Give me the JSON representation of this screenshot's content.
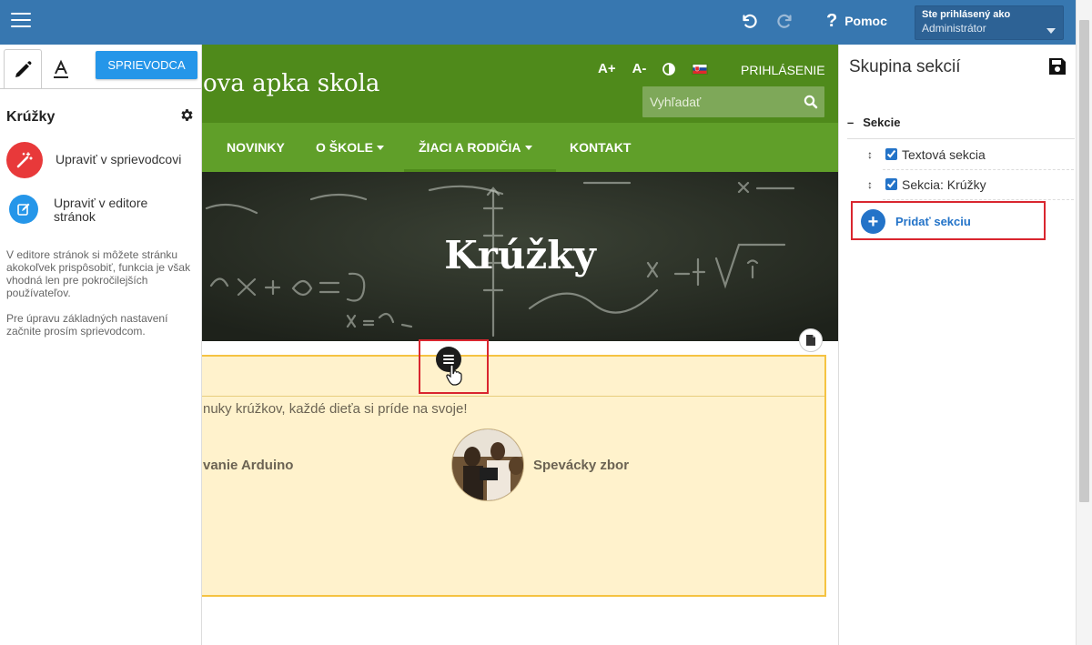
{
  "topbar": {
    "help_label": "Pomoc",
    "help_icon": "question-icon",
    "user_line1": "Ste prihlásený ako",
    "user_line2": "Administrátor"
  },
  "left_panel": {
    "guide_button": "SPRIEVODCA",
    "title": "Krúžky",
    "action_wizard": "Upraviť v sprievodcovi",
    "action_editor": "Upraviť v editore stránok",
    "desc1": "V editore stránok si môžete stránku akokoľvek prispôsobiť, funkcia je však vhodná len pre pokročilejších používateľov.",
    "desc2": "Pre úpravu základných nastavení začnite prosím sprievodcom."
  },
  "site": {
    "title": "ova apka skola",
    "font_plus": "A+",
    "font_minus": "A-",
    "login": "PRIHLÁSENIE",
    "search_placeholder": "Vyhľadať",
    "nav": [
      "NOVINKY",
      "O ŠKOLE",
      "ŽIACI A RODIČIA",
      "KONTAKT"
    ],
    "hero_title": "Krúžky",
    "section_text": "nuky krúžkov, každé dieťa si príde na svoje!",
    "card1": "vanie Arduino",
    "card2": "Spevácky zbor"
  },
  "right_panel": {
    "title": "Skupina sekcií",
    "group_label": "Sekcie",
    "sections": [
      "Textová sekcia",
      "Sekcia: Krúžky"
    ],
    "add_section": "Pridať sekciu"
  },
  "colors": {
    "topbar": "#3777b0",
    "accent": "#2596e9",
    "site_green": "#4f8a1b",
    "nav_green": "#609f29",
    "highlight": "#d9262f"
  }
}
